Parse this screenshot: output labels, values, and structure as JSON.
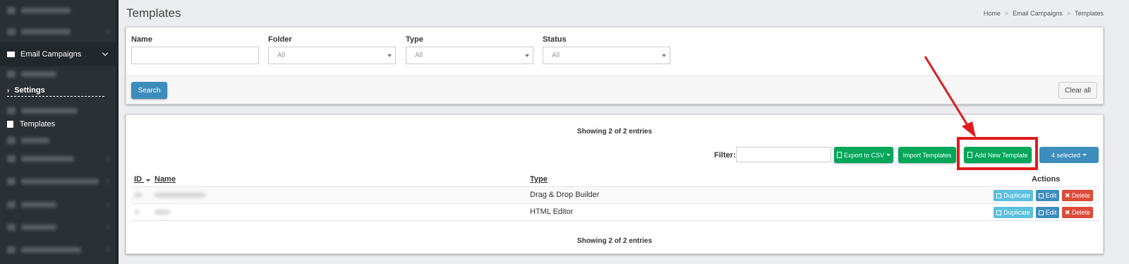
{
  "sidebar": {
    "email_campaigns_label": "Email Campaigns",
    "settings_label": "Settings",
    "templates_label": "Templates"
  },
  "header": {
    "title": "Templates",
    "breadcrumb": [
      "Home",
      "Email Campaigns",
      "Templates"
    ],
    "breadcrumb_sep": ">"
  },
  "filters": {
    "name_label": "Name",
    "name_value": "",
    "folder_label": "Folder",
    "folder_value": "All",
    "type_label": "Type",
    "type_value": "All",
    "status_label": "Status",
    "status_value": "All",
    "search_button": "Search",
    "clear_button": "Clear all"
  },
  "table": {
    "showing_top": "Showing 2 of 2 entries",
    "showing_bottom": "Showing 2 of 2 entries",
    "filter_label": "Filter:",
    "filter_value": "",
    "export_button": "Export to CSV",
    "import_button": "Import Templates",
    "add_button": "Add New Template",
    "selected_button": "4 selected",
    "columns": {
      "id": "ID",
      "name": "Name",
      "type": "Type",
      "actions": "Actions"
    },
    "rows": [
      {
        "type": "Drag & Drop Builder"
      },
      {
        "type": "HTML Editor"
      }
    ],
    "actions": {
      "duplicate": "Duplicate",
      "edit": "Edit",
      "delete": "Delete"
    }
  },
  "colors": {
    "sidebar_bg": "#2b3035",
    "primary_blue": "#3c8dbc",
    "success_green": "#00a65a",
    "danger_red": "#dd4b39",
    "info_cyan": "#5bc0de",
    "annotation_red": "#e01b1b"
  }
}
